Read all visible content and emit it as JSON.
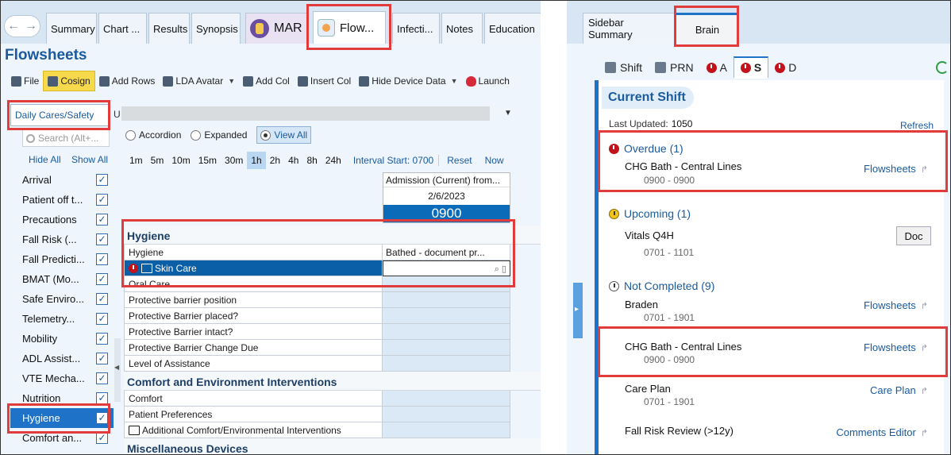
{
  "left": {
    "tabs": [
      "Summary",
      "Chart ...",
      "Results",
      "Synopsis",
      "MAR",
      "Flow...",
      "Infecti...",
      "Notes",
      "Education"
    ],
    "page_title": "Flowsheets",
    "toolbar": {
      "file": "File",
      "cosign": "Cosign",
      "add_rows": "Add Rows",
      "lda_avatar": "LDA Avatar",
      "add_col": "Add Col",
      "insert_col": "Insert Col",
      "hide_device_data": "Hide Device Data",
      "launch": "Launch"
    },
    "template_tab": "Daily Cares/Safety",
    "template_tab_next": "U",
    "search_placeholder": "Search (Alt+...",
    "hide_all": "Hide All",
    "show_all": "Show All",
    "side_items": [
      {
        "label": "Arrival",
        "checked": true
      },
      {
        "label": "Patient off t...",
        "checked": true
      },
      {
        "label": "Precautions",
        "checked": true
      },
      {
        "label": "Fall Risk (...",
        "checked": true
      },
      {
        "label": "Fall Predicti...",
        "checked": true
      },
      {
        "label": "BMAT (Mo...",
        "checked": true
      },
      {
        "label": "Safe Enviro...",
        "checked": true
      },
      {
        "label": "Telemetry...",
        "checked": true
      },
      {
        "label": "Mobility",
        "checked": true
      },
      {
        "label": "ADL Assist...",
        "checked": true
      },
      {
        "label": "VTE Mecha...",
        "checked": true
      },
      {
        "label": "Nutrition",
        "checked": true
      },
      {
        "label": "Hygiene",
        "checked": true
      },
      {
        "label": "Comfort an...",
        "checked": true
      }
    ],
    "view_options": [
      "Accordion",
      "Expanded",
      "View All"
    ],
    "intervals": [
      "1m",
      "5m",
      "10m",
      "15m",
      "30m",
      "1h",
      "2h",
      "4h",
      "8h",
      "24h"
    ],
    "interval_start": "Interval Start: 0700",
    "reset": "Reset",
    "now": "Now",
    "column": {
      "title": "Admission (Current) from...",
      "date": "2/6/2023",
      "time": "0900"
    },
    "sections": [
      {
        "title": "Hygiene",
        "rows": [
          {
            "name": "Hygiene",
            "value": "Bathed - document pr..."
          },
          {
            "name": "Skin Care",
            "value": ""
          },
          {
            "name": "Oral Care",
            "value": ""
          },
          {
            "name": "Protective barrier position",
            "value": ""
          },
          {
            "name": "Protective Barrier placed?",
            "value": ""
          },
          {
            "name": "Protective Barrier intact?",
            "value": ""
          },
          {
            "name": "Protective Barrier Change Due",
            "value": ""
          },
          {
            "name": "Level of Assistance",
            "value": ""
          }
        ]
      },
      {
        "title": "Comfort and Environment Interventions",
        "rows": [
          {
            "name": "Comfort",
            "value": ""
          },
          {
            "name": "Patient Preferences",
            "value": ""
          },
          {
            "name": "Additional Comfort/Environmental Interventions",
            "value": ""
          }
        ]
      },
      {
        "title": "Miscellaneous Devices",
        "rows": []
      }
    ]
  },
  "right": {
    "tabs": [
      "Sidebar Summary",
      "Brain"
    ],
    "sub_tabs": [
      "Shift",
      "PRN",
      "A",
      "S",
      "D"
    ],
    "panel_title": "Current Shift",
    "last_updated_label": "Last Updated:",
    "last_updated_value": "1050",
    "refresh": "Refresh",
    "groups": {
      "overdue": "Overdue (1)",
      "upcoming": "Upcoming (1)",
      "not_completed": "Not Completed (9)"
    },
    "tasks": [
      {
        "name": "CHG Bath - Central Lines",
        "time": "0900 - 0900",
        "action": "Flowsheets"
      },
      {
        "name": "Vitals Q4H",
        "time": "0701 - 1101",
        "action": "Doc"
      },
      {
        "name": "Braden",
        "time": "0701 - 1901",
        "action": "Flowsheets"
      },
      {
        "name": "CHG Bath - Central Lines",
        "time": "0900 - 0900",
        "action": "Flowsheets"
      },
      {
        "name": "Care Plan",
        "time": "0701 - 1901",
        "action": "Care Plan"
      },
      {
        "name": "Fall Risk Review (>12y)",
        "time": "",
        "action": "Comments Editor"
      }
    ]
  },
  "colors": {
    "accent_blue": "#1e73c9",
    "title_blue": "#1a5a9e",
    "selected_row": "#0b5fa6",
    "alarm_red": "#c2121c",
    "callout_red": "#e23b3b",
    "cosign_yellow": "#f7d94c"
  }
}
